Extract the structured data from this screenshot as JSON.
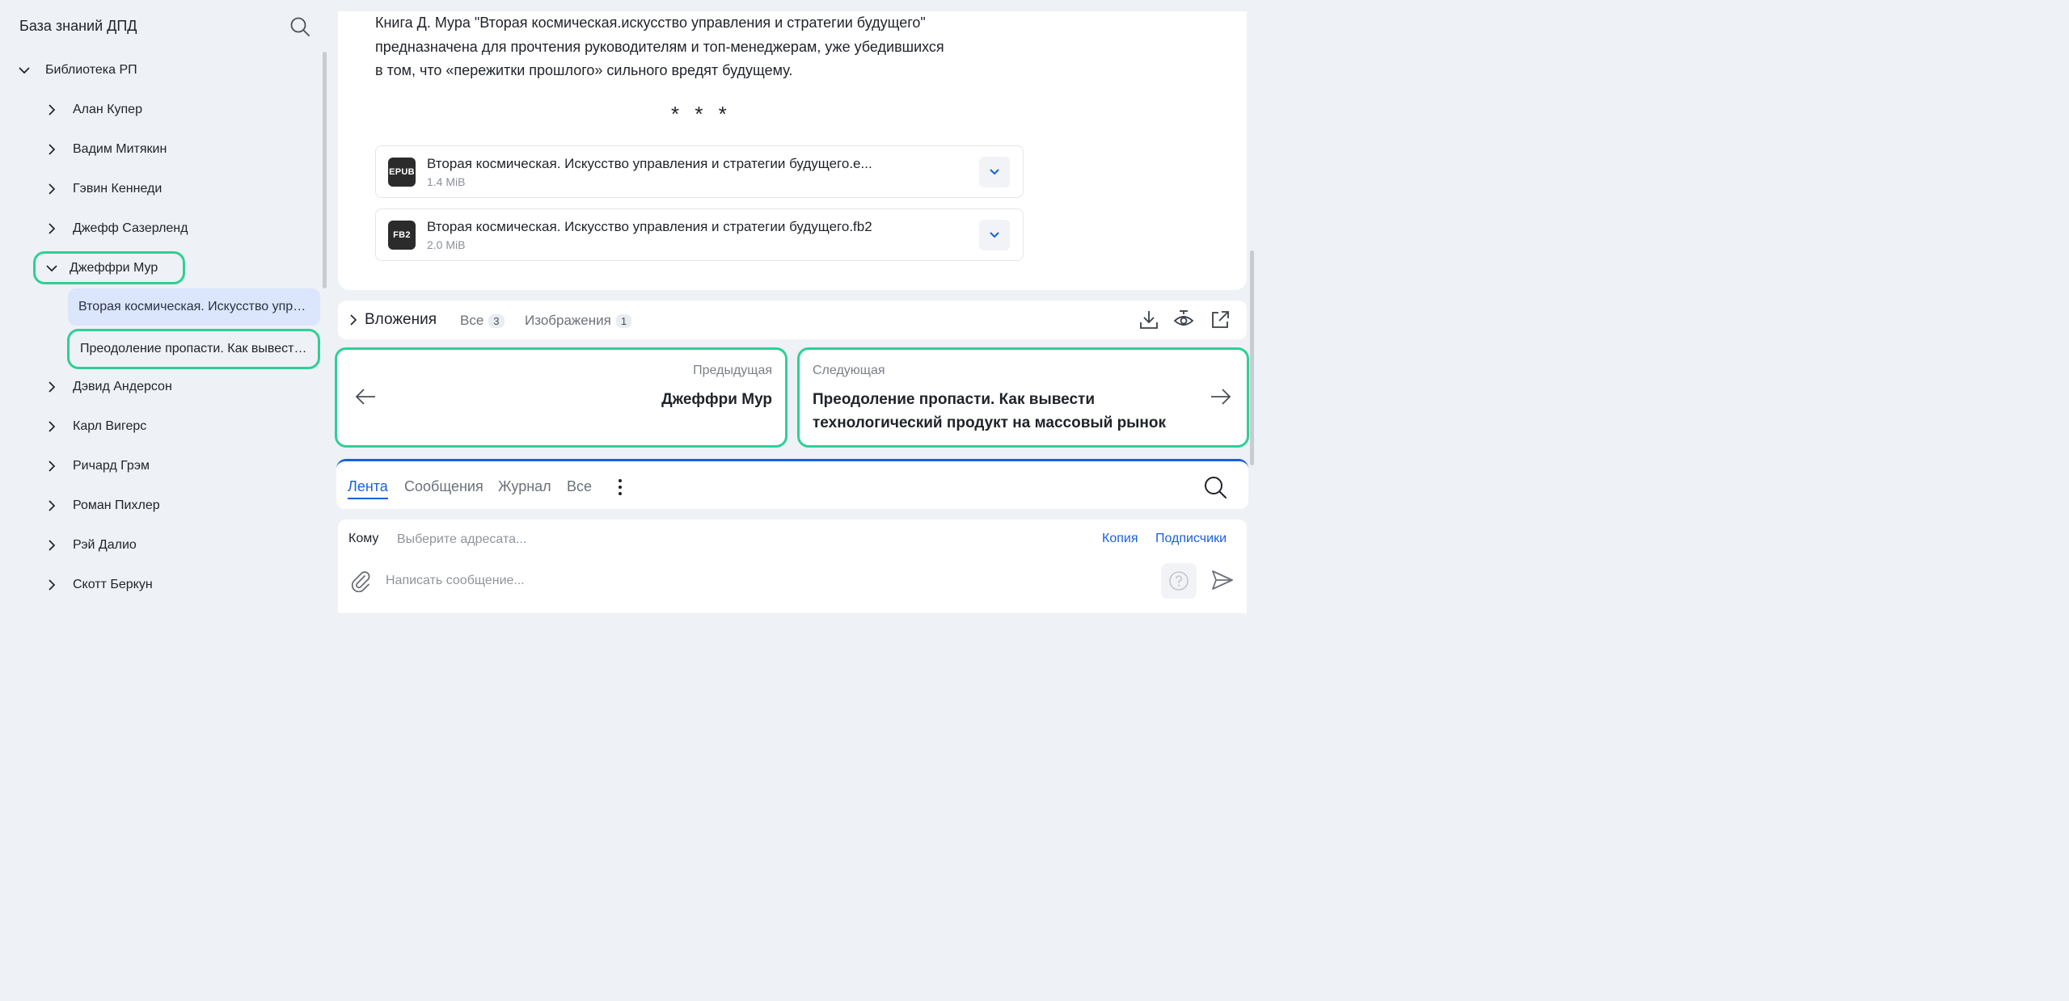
{
  "sidebar": {
    "title": "База знаний ДПД",
    "root": "Библиотека РП",
    "items": [
      {
        "label": "Алан Купер"
      },
      {
        "label": "Вадим Митякин"
      },
      {
        "label": "Гэвин Кеннеди"
      },
      {
        "label": "Джефф Сазерленд"
      },
      {
        "label": "Джеффри Мур"
      },
      {
        "label": "Дэвид Андерсон"
      },
      {
        "label": "Карл Вигерс"
      },
      {
        "label": "Ричард Грэм"
      },
      {
        "label": "Роман Пихлер"
      },
      {
        "label": "Рэй Далио"
      },
      {
        "label": "Скотт Беркун"
      }
    ],
    "children": [
      {
        "label": "Вторая космическая. Искусство управления и стратегии будущего",
        "active": true
      },
      {
        "label": "Преодоление пропасти. Как вывести технологический продукт на массовый рынок",
        "active": false
      }
    ]
  },
  "content": {
    "description_lines": [
      "Книга Д. Мура \"Вторая космическая.искусство управления и стратегии будущего\"",
      "предназначена для прочтения руководителям и топ-менеджерам, уже убедившихся",
      "в том, что «пережитки прошлого» сильного вредят будущему."
    ],
    "separator": "* * *",
    "files": [
      {
        "badge": "EPUB",
        "name": "Вторая космическая. Искусство управления и стратегии будущего.e...",
        "size": "1.4 MiB"
      },
      {
        "badge": "FB2",
        "name": "Вторая космическая. Искусство управления и стратегии будущего.fb2",
        "size": "2.0 MiB"
      }
    ]
  },
  "attachments": {
    "title": "Вложения",
    "tabs": [
      {
        "label": "Все",
        "count": "3"
      },
      {
        "label": "Изображения",
        "count": "1"
      }
    ]
  },
  "navigation": {
    "prev_caption": "Предыдущая",
    "prev_title": "Джеффри Мур",
    "next_caption": "Следующая",
    "next_title_line1": "Преодоление пропасти. Как вывести",
    "next_title_line2": "технологический продукт на массовый рынок"
  },
  "feed": {
    "tabs": [
      "Лента",
      "Сообщения",
      "Журнал",
      "Все"
    ],
    "active_tab": "Лента"
  },
  "compose": {
    "to_label": "Кому",
    "to_placeholder": "Выберите адресата...",
    "copy_link": "Копия",
    "subscribers_link": "Подписчики",
    "message_placeholder": "Написать сообщение..."
  },
  "colors": {
    "accent": "#1a5fe0",
    "highlight": "#2fcf95",
    "active_item_bg": "#dbe5fb",
    "background": "#eef1f5"
  },
  "icons": [
    "search-icon",
    "chevron-right-icon",
    "chevron-down-icon",
    "download-icon",
    "eye-icon",
    "open-external-icon",
    "arrow-left-icon",
    "arrow-right-icon",
    "more-vertical-icon",
    "paperclip-icon",
    "help-icon",
    "send-icon"
  ]
}
